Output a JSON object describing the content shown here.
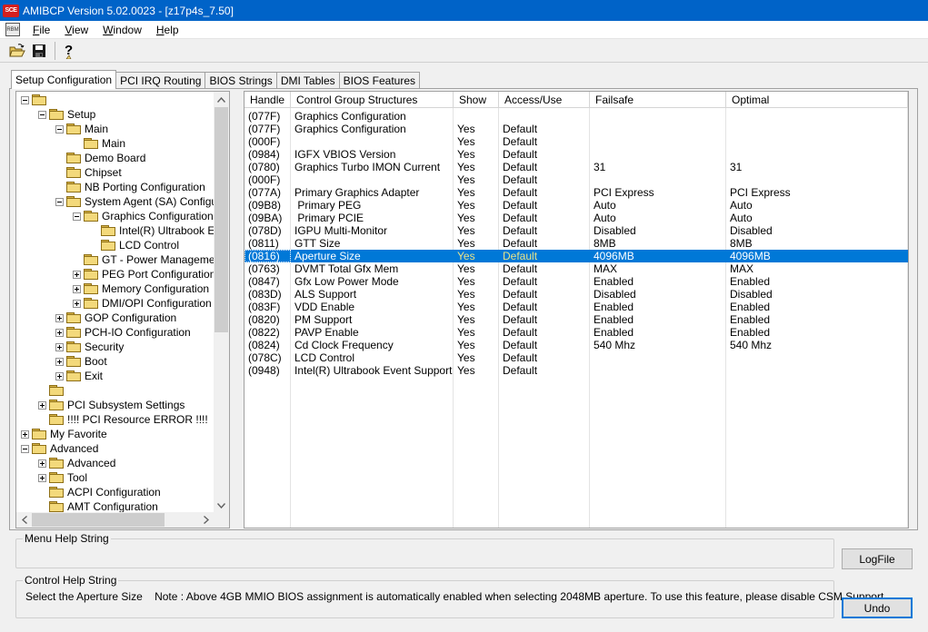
{
  "window": {
    "title": "AMIBCP Version 5.02.0023 - [z17p4s_7.50]",
    "icon_label": "SCE"
  },
  "menu": {
    "mdi_icon_label": "RBM",
    "items": [
      {
        "label": "File",
        "accel": "F",
        "rest": "ile"
      },
      {
        "label": "View",
        "accel": "V",
        "rest": "iew"
      },
      {
        "label": "Window",
        "accel": "W",
        "rest": "indow"
      },
      {
        "label": "Help",
        "accel": "H",
        "rest": "elp"
      }
    ]
  },
  "toolbar": {
    "icons": [
      "open-folder-icon",
      "save-icon",
      "help-icon"
    ]
  },
  "tabs": [
    {
      "label": "Setup Configuration",
      "active": true
    },
    {
      "label": "PCI IRQ Routing",
      "active": false
    },
    {
      "label": "BIOS Strings",
      "active": false
    },
    {
      "label": "DMI Tables",
      "active": false
    },
    {
      "label": "BIOS Features",
      "active": false
    }
  ],
  "tree": {
    "items": [
      {
        "label": "",
        "depth": 0,
        "expander": "minus"
      },
      {
        "label": "Setup",
        "depth": 1,
        "expander": "minus"
      },
      {
        "label": "Main",
        "depth": 2,
        "expander": "minus"
      },
      {
        "label": "Main",
        "depth": 3,
        "expander": "none"
      },
      {
        "label": "Demo Board",
        "depth": 2,
        "expander": "none"
      },
      {
        "label": "Chipset",
        "depth": 2,
        "expander": "none"
      },
      {
        "label": "NB Porting Configuration",
        "depth": 2,
        "expander": "none"
      },
      {
        "label": "System Agent (SA) Configurati",
        "depth": 2,
        "expander": "minus"
      },
      {
        "label": "Graphics Configuration",
        "depth": 3,
        "expander": "minus",
        "open": true
      },
      {
        "label": "Intel(R) Ultrabook Ev",
        "depth": 4,
        "expander": "none"
      },
      {
        "label": "LCD Control",
        "depth": 4,
        "expander": "none"
      },
      {
        "label": "GT - Power Management",
        "depth": 3,
        "expander": "none"
      },
      {
        "label": "PEG Port Configuration",
        "depth": 3,
        "expander": "plus"
      },
      {
        "label": "Memory Configuration",
        "depth": 3,
        "expander": "plus"
      },
      {
        "label": "DMI/OPI Configuration",
        "depth": 3,
        "expander": "plus"
      },
      {
        "label": "GOP Configuration",
        "depth": 2,
        "expander": "plus"
      },
      {
        "label": "PCH-IO Configuration",
        "depth": 2,
        "expander": "plus"
      },
      {
        "label": "Security",
        "depth": 2,
        "expander": "plus"
      },
      {
        "label": "Boot",
        "depth": 2,
        "expander": "plus"
      },
      {
        "label": "Exit",
        "depth": 2,
        "expander": "plus"
      },
      {
        "label": "",
        "depth": 1,
        "expander": "none"
      },
      {
        "label": "PCI Subsystem Settings",
        "depth": 1,
        "expander": "plus"
      },
      {
        "label": "!!!! PCI Resource ERROR !!!!",
        "depth": 1,
        "expander": "none"
      },
      {
        "label": "My Favorite",
        "depth": 0,
        "expander": "plus"
      },
      {
        "label": "Advanced",
        "depth": 0,
        "expander": "minus"
      },
      {
        "label": "Advanced",
        "depth": 1,
        "expander": "plus"
      },
      {
        "label": "Tool",
        "depth": 1,
        "expander": "plus"
      },
      {
        "label": "ACPI Configuration",
        "depth": 1,
        "expander": "none"
      },
      {
        "label": "AMT Configuration",
        "depth": 1,
        "expander": "none"
      }
    ]
  },
  "grid": {
    "columns": [
      "Handle",
      "Control Group Structures",
      "Show",
      "Access/Use",
      "Failsafe",
      "Optimal"
    ],
    "selected_index": 11,
    "rows": [
      [
        "(077F)",
        "Graphics Configuration",
        "",
        "",
        "",
        ""
      ],
      [
        "(077F)",
        "Graphics Configuration",
        "Yes",
        "Default",
        "",
        ""
      ],
      [
        "(000F)",
        "",
        "Yes",
        "Default",
        "",
        ""
      ],
      [
        "(0984)",
        "IGFX VBIOS Version",
        "Yes",
        "Default",
        "",
        ""
      ],
      [
        "(0780)",
        "Graphics Turbo IMON Current",
        "Yes",
        "Default",
        "31",
        "31"
      ],
      [
        "(000F)",
        "",
        "Yes",
        "Default",
        "",
        ""
      ],
      [
        "(077A)",
        "Primary Graphics Adapter",
        "Yes",
        "Default",
        "PCI Express",
        "PCI Express"
      ],
      [
        "(09B8)",
        " Primary PEG",
        "Yes",
        "Default",
        "Auto",
        "Auto"
      ],
      [
        "(09BA)",
        " Primary PCIE",
        "Yes",
        "Default",
        "Auto",
        "Auto"
      ],
      [
        "(078D)",
        "IGPU Multi-Monitor",
        "Yes",
        "Default",
        "Disabled",
        "Disabled"
      ],
      [
        "(0811)",
        "GTT Size",
        "Yes",
        "Default",
        "8MB",
        "8MB"
      ],
      [
        "(0816)",
        "Aperture Size",
        "Yes",
        "Default",
        "4096MB",
        "4096MB"
      ],
      [
        "(0763)",
        "DVMT Total Gfx Mem",
        "Yes",
        "Default",
        "MAX",
        "MAX"
      ],
      [
        "(0847)",
        "Gfx Low Power Mode",
        "Yes",
        "Default",
        "Enabled",
        "Enabled"
      ],
      [
        "(083D)",
        "ALS Support",
        "Yes",
        "Default",
        "Disabled",
        "Disabled"
      ],
      [
        "(083F)",
        "VDD Enable",
        "Yes",
        "Default",
        "Enabled",
        "Enabled"
      ],
      [
        "(0820)",
        "PM Support",
        "Yes",
        "Default",
        "Enabled",
        "Enabled"
      ],
      [
        "(0822)",
        "PAVP Enable",
        "Yes",
        "Default",
        "Enabled",
        "Enabled"
      ],
      [
        "(0824)",
        "Cd Clock Frequency",
        "Yes",
        "Default",
        "540 Mhz",
        "540 Mhz"
      ],
      [
        "(078C)",
        "LCD Control",
        "Yes",
        "Default",
        "",
        ""
      ],
      [
        "(0948)",
        "Intel(R) Ultrabook Event Support",
        "Yes",
        "Default",
        "",
        ""
      ]
    ]
  },
  "menu_help": {
    "legend": "Menu Help String",
    "text": ""
  },
  "control_help": {
    "legend": "Control Help String",
    "text": "Select the Aperture Size    Note : Above 4GB MMIO BIOS assignment is automatically enabled when selecting 2048MB aperture. To use this feature, please disable CSM Support."
  },
  "buttons": {
    "logfile": "LogFile",
    "undo": "Undo"
  },
  "colors": {
    "titlebar": "#0063c8",
    "selection": "#0078d7",
    "folder": "#f3d97b"
  }
}
